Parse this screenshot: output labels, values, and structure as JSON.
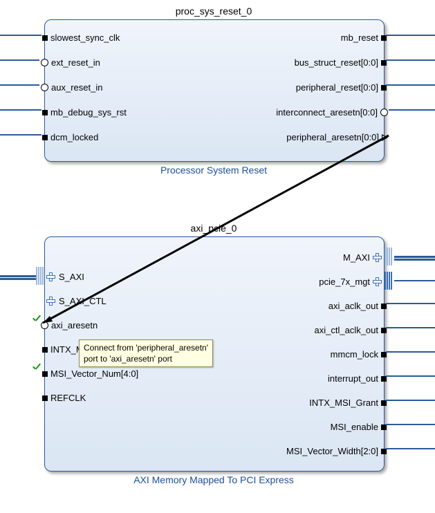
{
  "blocks": {
    "reset": {
      "instance": "proc_sys_reset_0",
      "name": "Processor System Reset",
      "left_ports": [
        "slowest_sync_clk",
        "ext_reset_in",
        "aux_reset_in",
        "mb_debug_sys_rst",
        "dcm_locked"
      ],
      "right_ports": [
        "mb_reset",
        "bus_struct_reset[0:0]",
        "peripheral_reset[0:0]",
        "interconnect_aresetn[0:0]",
        "peripheral_aresetn[0:0]"
      ]
    },
    "pcie": {
      "instance": "axi_pcie_0",
      "name": "AXI Memory Mapped To PCI Express",
      "left_ports": [
        "S_AXI",
        "S_AXI_CTL",
        "axi_aresetn",
        "INTX_MSI_Request",
        "MSI_Vector_Num[4:0]",
        "REFCLK"
      ],
      "right_ports": [
        "M_AXI",
        "pcie_7x_mgt",
        "axi_aclk_out",
        "axi_ctl_aclk_out",
        "mmcm_lock",
        "interrupt_out",
        "INTX_MSI_Grant",
        "MSI_enable",
        "MSI_Vector_Width[2:0]"
      ]
    }
  },
  "tooltip": {
    "line1": "Connect from 'peripheral_aresetn'",
    "line2": "port to 'axi_aresetn' port"
  },
  "connection": {
    "from": "peripheral_aresetn[0:0]",
    "to": "axi_aresetn"
  }
}
